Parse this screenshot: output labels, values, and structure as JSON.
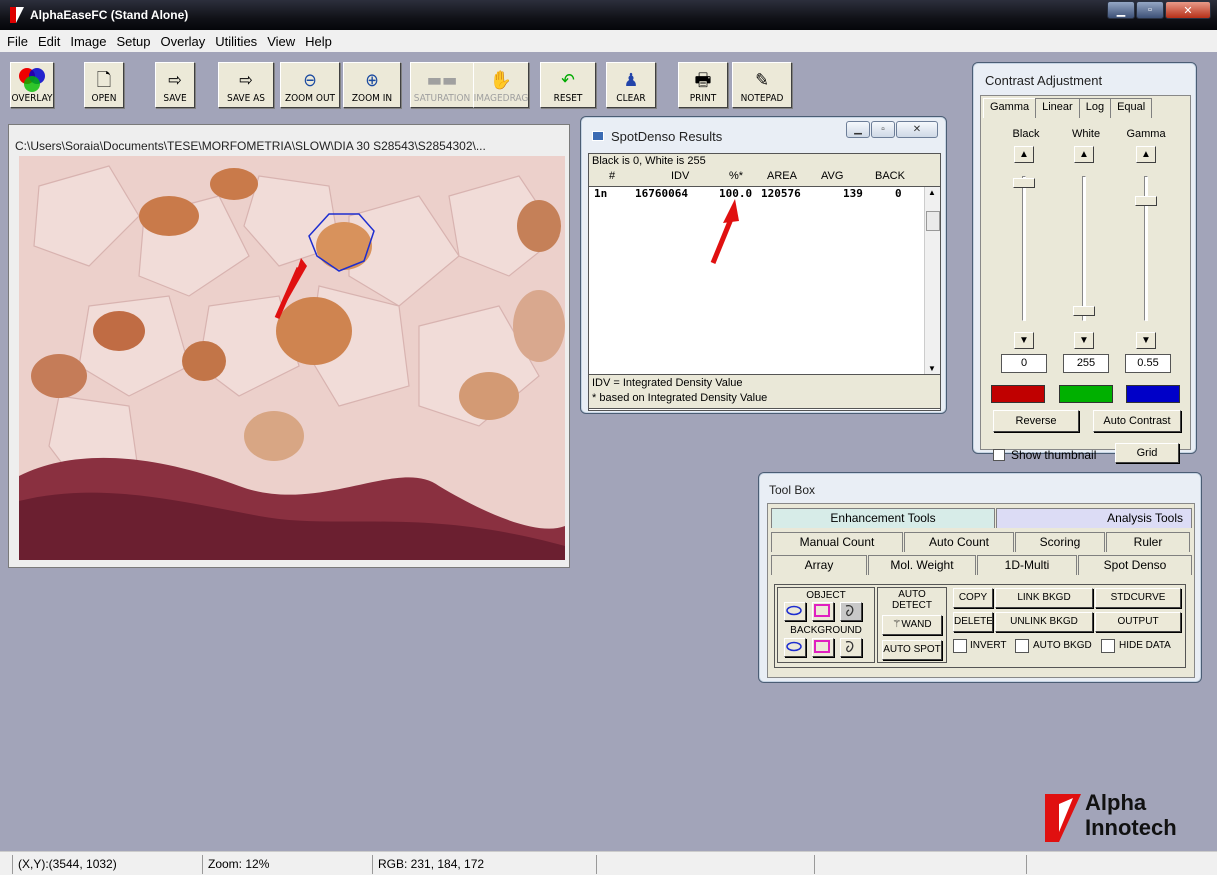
{
  "window": {
    "title": "AlphaEaseFC (Stand Alone)"
  },
  "menu": [
    "File",
    "Edit",
    "Image",
    "Setup",
    "Overlay",
    "Utilities",
    "View",
    "Help"
  ],
  "toolbar": {
    "overlay": "OVERLAY",
    "open": "OPEN",
    "save": "SAVE",
    "save_as": "SAVE AS",
    "zoom_out": "ZOOM OUT",
    "zoom_in": "ZOOM IN",
    "saturation": "SATURATION",
    "image_drag": "IMAGEDRAG",
    "reset": "RESET",
    "clear": "CLEAR",
    "print": "PRINT",
    "notepad": "NOTEPAD"
  },
  "image_window": {
    "path": "C:\\Users\\Soraia\\Documents\\TESE\\MORFOMETRIA\\SLOW\\DIA 30 S28543\\S2854302\\..."
  },
  "spotdenso": {
    "title": "SpotDenso Results",
    "header_note": "Black is 0, White is 255",
    "columns": [
      "#",
      "IDV",
      "%*",
      "AREA",
      "AVG",
      "BACK"
    ],
    "rows": [
      [
        "1n",
        "16760064",
        "100.0",
        "120576",
        "139",
        "0"
      ]
    ],
    "footnote1": "IDV = Integrated Density Value",
    "footnote2": "* based on Integrated Density Value"
  },
  "contrast": {
    "title": "Contrast Adjustment",
    "tabs": [
      "Gamma",
      "Linear",
      "Log",
      "Equal"
    ],
    "channels": [
      "Black",
      "White",
      "Gamma"
    ],
    "values": [
      "0",
      "255",
      "0.55"
    ],
    "swatch_colors": [
      "#c00000",
      "#00b000",
      "#0000c8"
    ],
    "reverse": "Reverse",
    "auto_contrast": "Auto Contrast",
    "show_thumbnail": "Show thumbnail",
    "grid": "Grid"
  },
  "toolbox": {
    "title": "Tool Box",
    "top_tabs": [
      "Enhancement Tools",
      "Analysis Tools"
    ],
    "row2_tabs": [
      "Manual Count",
      "Auto Count",
      "Scoring",
      "Ruler"
    ],
    "row3_tabs": [
      "Array",
      "Mol. Weight",
      "1D-Multi",
      "Spot Denso"
    ],
    "object_label": "OBJECT",
    "background_label": "BACKGROUND",
    "auto_detect": "AUTO DETECT",
    "wand": "WAND",
    "auto_spot": "AUTO SPOT",
    "copy": "COPY",
    "link_bkgd": "LINK BKGD",
    "stdcurve": "STDCURVE",
    "delete": "DELETE",
    "unlink_bkgd": "UNLINK BKGD",
    "output": "OUTPUT",
    "invert": "INVERT",
    "auto_bkgd": "AUTO BKGD",
    "hide_data": "HIDE DATA"
  },
  "status": {
    "xy": "(X,Y):(3544, 1032)",
    "zoom": "Zoom: 12%",
    "rgb": "RGB: 231, 184, 172"
  },
  "logo": {
    "line1": "Alpha",
    "line2": "Innotech"
  }
}
